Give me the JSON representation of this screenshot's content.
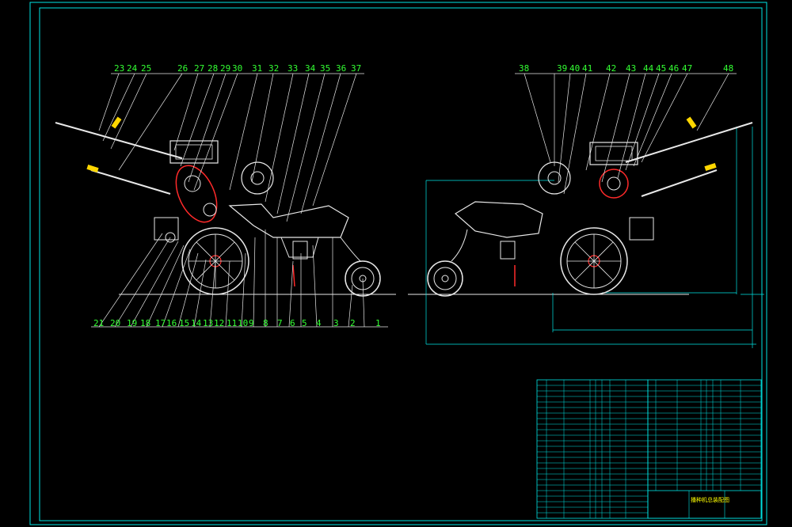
{
  "colors": {
    "background": "#000000",
    "frame": "#00e5e5",
    "outline": "#e8e8e8",
    "callout_text": "#33ff33",
    "hidden_line": "#ff2a2a",
    "handle": "#ffd700",
    "table_text": "#ffff00"
  },
  "left_view": {
    "top_callouts": [
      "23",
      "24",
      "25",
      "26",
      "27",
      "28",
      "29",
      "30",
      "31",
      "32",
      "33",
      "34",
      "35",
      "36",
      "37"
    ],
    "bottom_callouts": [
      "21",
      "20",
      "19",
      "18",
      "17",
      "16",
      "15",
      "14",
      "13",
      "12",
      "11",
      "10",
      "9",
      "8",
      "7",
      "6",
      "5",
      "4",
      "3",
      "2",
      "1"
    ]
  },
  "right_view": {
    "top_callouts": [
      "38",
      "39",
      "40",
      "41",
      "42",
      "43",
      "44",
      "45",
      "46",
      "47",
      "48"
    ]
  },
  "title_block": {
    "drawing_title": "播种机总装配图"
  }
}
